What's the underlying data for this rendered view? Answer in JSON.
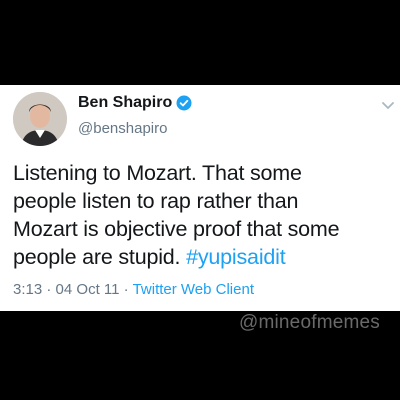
{
  "tweet": {
    "author_name": "Ben Shapiro",
    "author_handle": "@benshapiro",
    "text_line1": "Listening to Mozart. That some",
    "text_line2": "people listen to rap rather than",
    "text_line3": "Mozart is objective proof that some",
    "text_line4_plain": "people are stupid. ",
    "hashtag": "#yupisaidit",
    "time": "3:13",
    "date": "04 Oct 11",
    "separator": "·",
    "client": "Twitter Web Client"
  },
  "icons": {
    "verified": "verified-badge-icon",
    "menu": "chevron-down-icon"
  },
  "watermark": "@mineofmemes",
  "colors": {
    "link_blue": "#1da1f2",
    "secondary_gray": "#657786",
    "background": "#000000",
    "card": "#ffffff"
  }
}
